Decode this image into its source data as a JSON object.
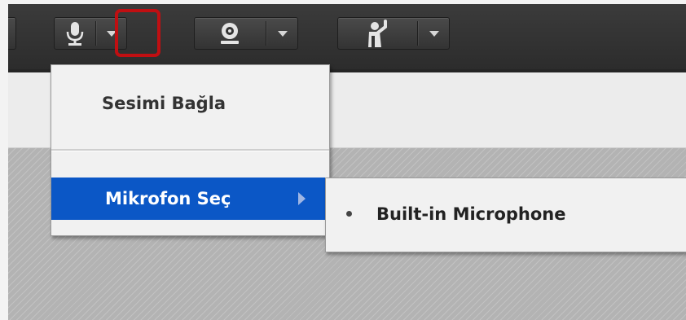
{
  "toolbar": {
    "buttons": [
      {
        "icon": "microphone-icon",
        "has_dropdown": true
      },
      {
        "icon": "webcam-icon",
        "has_dropdown": true
      },
      {
        "icon": "raise-hand-icon",
        "has_dropdown": true
      }
    ],
    "highlight_color": "#c00f12"
  },
  "menu": {
    "connect_audio": "Sesimi Bağla",
    "select_microphone": "Mikrofon Seç",
    "selected_item_color": "#0b57c6"
  },
  "submenu": {
    "items": [
      {
        "label": "Built-in Microphone",
        "selected": true
      }
    ]
  }
}
